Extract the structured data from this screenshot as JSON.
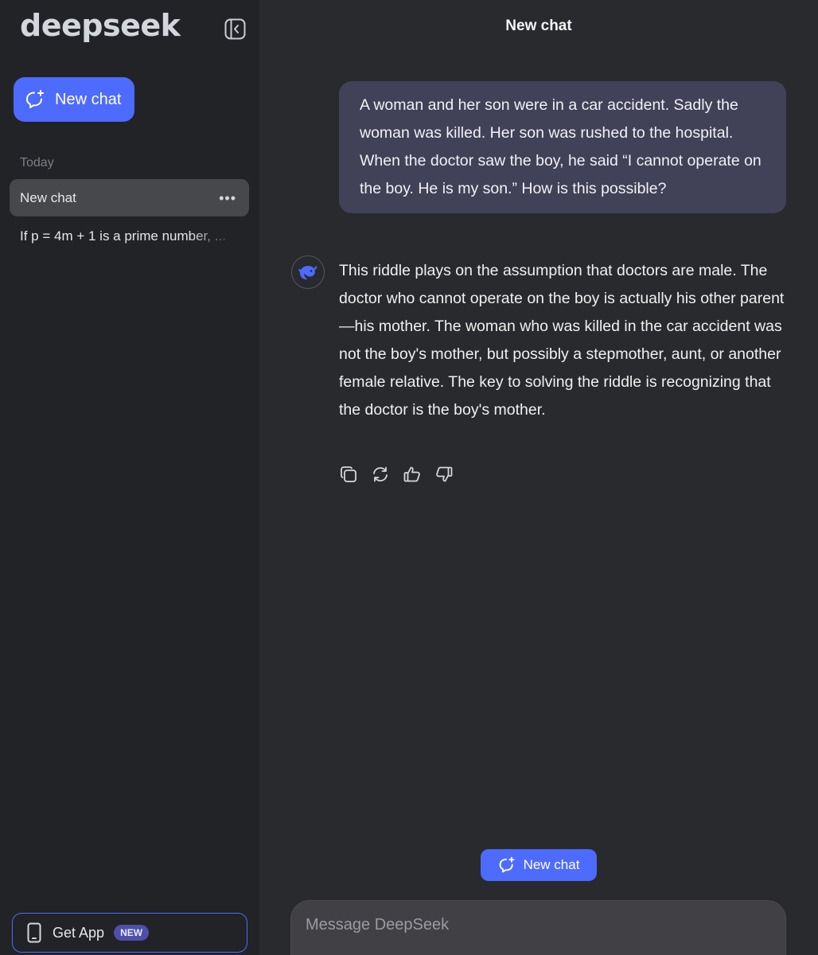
{
  "sidebar": {
    "logo_text": "deepseek",
    "new_chat_label": "New chat",
    "section_today": "Today",
    "chats": [
      {
        "label": "New chat",
        "active": true
      },
      {
        "label": "If p = 4m + 1 is a prime number, ...",
        "active": false
      }
    ],
    "get_app_label": "Get App",
    "get_app_badge": "NEW"
  },
  "header": {
    "title": "New chat"
  },
  "conversation": {
    "user_message": "A woman and her son were in a car accident. Sadly the woman was killed. Her son was rushed to the hospital. When the doctor saw the boy, he said “I cannot operate on the boy. He is my son.” How is this possible?",
    "assistant_message": "This riddle plays on the assumption that doctors are male. The doctor who cannot operate on the boy is actually his other parent—his mother. The woman who was killed in the car accident was not the boy's mother, but possibly a stepmother, aunt, or another female relative. The key to solving the riddle is recognizing that the doctor is the boy's mother.",
    "actions": [
      "copy-icon",
      "regenerate-icon",
      "thumbs-up-icon",
      "thumbs-down-icon"
    ]
  },
  "floating_new_chat_label": "New chat",
  "composer": {
    "placeholder": "Message DeepSeek"
  },
  "colors": {
    "accent": "#4d6bfe",
    "sidebar_bg": "#212327",
    "main_bg": "#292a2d",
    "user_bubble": "#414158"
  }
}
